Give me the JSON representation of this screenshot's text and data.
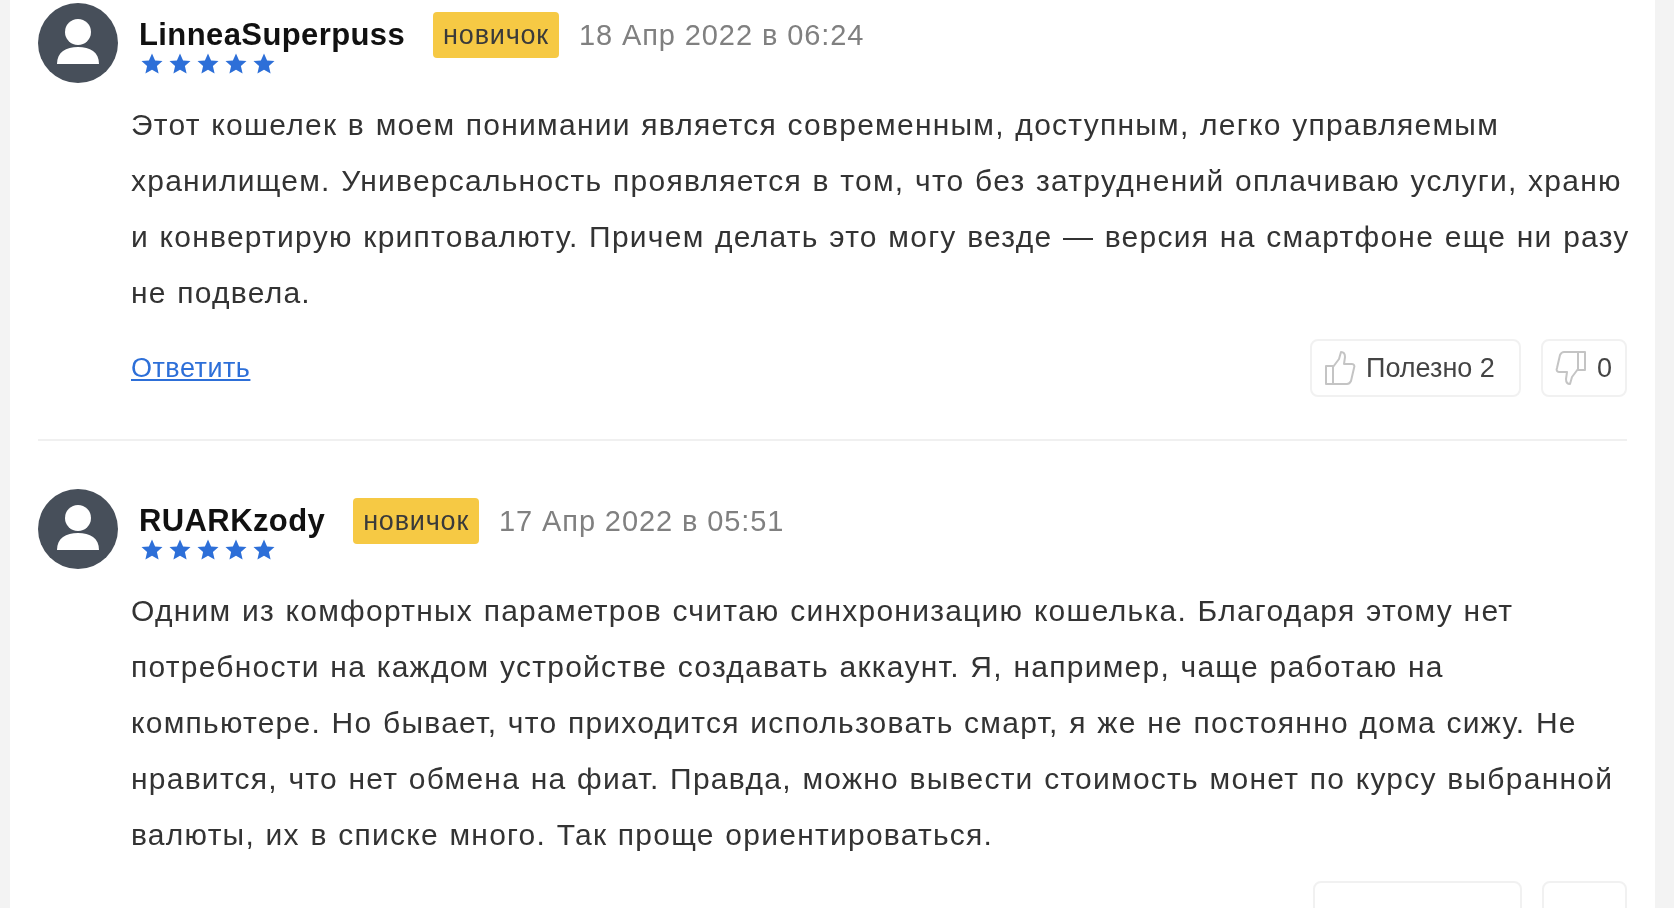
{
  "reviews": [
    {
      "author": "LinneaSuperpuss",
      "badge": "новичок",
      "date": "18 Апр 2022 в 06:24",
      "stars": 5,
      "text": "Этот кошелек в моем понимании является современным, доступным, легко управляемым хранилищем. Универсальность проявляется в том, что без затруднений оплачиваю услуги, храню и конвертирую криптовалюту. Причем делать это могу везде — версия на смартфоне еще ни разу не подвела.",
      "reply": "Ответить",
      "helpful": {
        "label": "Полезно",
        "count": "2"
      },
      "unhelpful": {
        "count": "0"
      }
    },
    {
      "author": "RUARKzody",
      "badge": "новичок",
      "date": "17 Апр 2022 в 05:51",
      "stars": 5,
      "text": "Одним из комфортных параметров считаю синхронизацию кошелька. Благодаря этому нет потребности на каждом устройстве создавать аккаунт. Я, например, чаще работаю на компьютере. Но бывает, что приходится использовать смарт, я же не постоянно дома сижу. Не нравится, что нет обмена на фиат. Правда, можно вывести стоимость монет по курсу выбранной валюты, их в списке много. Так проще ориентироваться."
    }
  ]
}
